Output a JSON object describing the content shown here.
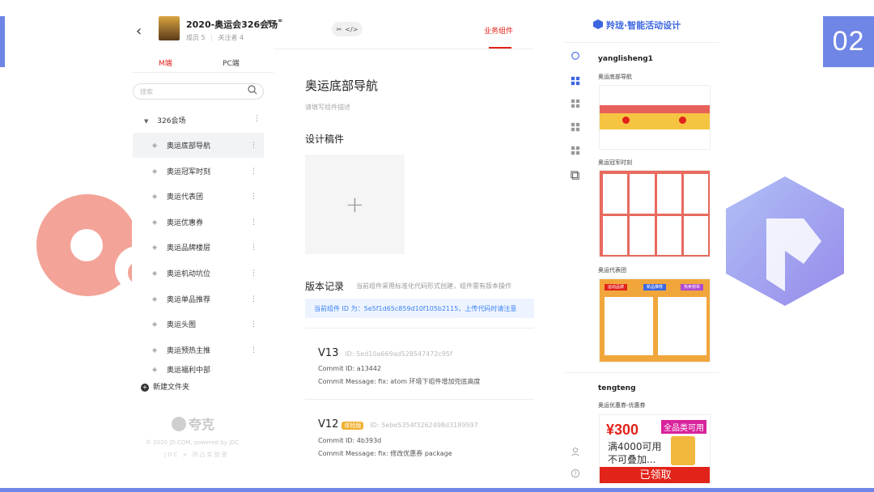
{
  "slide": {
    "number": "02"
  },
  "project": {
    "title": "2020-奥运会326会场",
    "members": "成员 5",
    "followers": "关注者 4"
  },
  "left_tabs": {
    "mobile": "M端",
    "pc": "PC端"
  },
  "search": {
    "placeholder": "搜索"
  },
  "tree": {
    "group": "326会场",
    "items": [
      {
        "label": "奥运底部导航"
      },
      {
        "label": "奥运冠军时刻"
      },
      {
        "label": "奥运代表团"
      },
      {
        "label": "奥运优惠券"
      },
      {
        "label": "奥运品牌楼层"
      },
      {
        "label": "奥运机动坑位"
      },
      {
        "label": "奥运单品推荐"
      },
      {
        "label": "奥运头图"
      },
      {
        "label": "奥运预热主推"
      },
      {
        "label": "奥运福利中部"
      }
    ],
    "new_folder": "新建文件夹"
  },
  "footer": {
    "logo": "夸克",
    "line1": "© 2020 JD.COM, powered by JDC",
    "line2": "JDC × 凹凸实验室"
  },
  "toolbar": {
    "biz_tab": "业务组件"
  },
  "component": {
    "title": "奥运底部导航",
    "desc_placeholder": "请填写组件描述",
    "design_title": "设计稿件",
    "upload_plus": "+",
    "version_title": "版本记录",
    "version_hint": "当前组件采用标准化代码形式创建，组件需有版本操作",
    "id_banner": "当前组件 ID 为：5e5f1d65c859d10f105b2115，上传代码时请注意",
    "versions": [
      {
        "label": "V13",
        "id": "ID: 5ed10a669ad528547472c95f",
        "tag": "",
        "commit_id": "Commit ID: a13442",
        "commit_msg": "Commit Message: fix: atom 环境下组件增加兜底高度"
      },
      {
        "label": "V12",
        "id": "ID: 5ebe5354f3262498d3189597",
        "tag": "体验版",
        "commit_id": "Commit ID: 4b393d",
        "commit_msg": "Commit Message: fix: 修改优惠券 package"
      }
    ]
  },
  "right": {
    "brand": "羚珑·智能活动设计",
    "users": [
      {
        "name": "yanglisheng1",
        "captions": [
          "奥运底部导航",
          "奥运冠军时刻",
          "奥运代表团"
        ]
      },
      {
        "name": "tengteng",
        "captions": [
          "奥运优惠券-优惠券"
        ]
      }
    ],
    "coupon": {
      "price": "¥300",
      "badge": "全品类可用",
      "cond": "满4000可用",
      "note": "不可叠加...",
      "btn": "已领取"
    },
    "card_labels": {
      "hot": "运动品牌",
      "rank": "热卖榜单",
      "new": "新品推荐"
    }
  },
  "colors": {
    "accent_red": "#e2231a",
    "brand_blue": "#3d67e0",
    "slide_blue": "#6f86e6",
    "deco_pink": "#f4a398"
  }
}
